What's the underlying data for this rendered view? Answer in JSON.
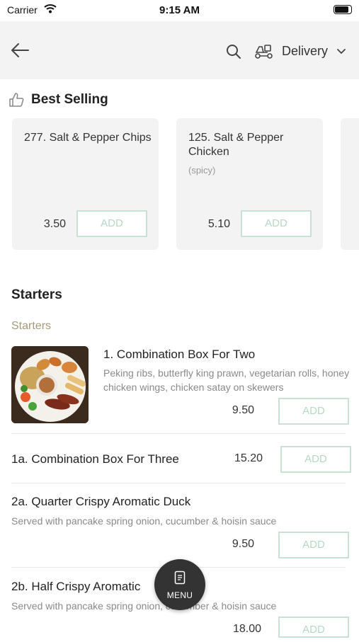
{
  "status_bar": {
    "carrier": "Carrier",
    "time": "9:15 AM"
  },
  "header": {
    "delivery_label": "Delivery"
  },
  "best_selling": {
    "title": "Best Selling",
    "items": [
      {
        "name": "277. Salt & Pepper Chips",
        "subtitle": "",
        "price": "3.50",
        "add_label": "ADD"
      },
      {
        "name": "125. Salt & Pepper Chicken",
        "subtitle": "(spicy)",
        "price": "5.10",
        "add_label": "ADD"
      }
    ]
  },
  "starters": {
    "title": "Starters",
    "subtitle": "Starters",
    "items": [
      {
        "name": "1. Combination Box For Two",
        "description": "Peking ribs, butterfly king prawn, vegetarian rolls, honey chicken wings, chicken satay on skewers",
        "price": "9.50",
        "add_label": "ADD"
      },
      {
        "name": "1a. Combination Box For Three",
        "description": "",
        "price": "15.20",
        "add_label": "ADD"
      },
      {
        "name": "2a. Quarter Crispy Aromatic Duck",
        "description": "Served with pancake spring onion, cucumber & hoisin sauce",
        "price": "9.50",
        "add_label": "ADD"
      },
      {
        "name": "2b. Half Crispy Aromatic",
        "description": "Served with pancake spring onion, cucumber & hoisin sauce",
        "price": "18.00",
        "add_label": "ADD"
      }
    ]
  },
  "menu_button": {
    "label": "MENU"
  },
  "colors": {
    "header_bg": "#f3f3f3",
    "add_border": "#c8e2d3",
    "add_text": "#b6d8c4",
    "subtitle_accent": "#a89a79",
    "fab_bg": "#333333"
  }
}
